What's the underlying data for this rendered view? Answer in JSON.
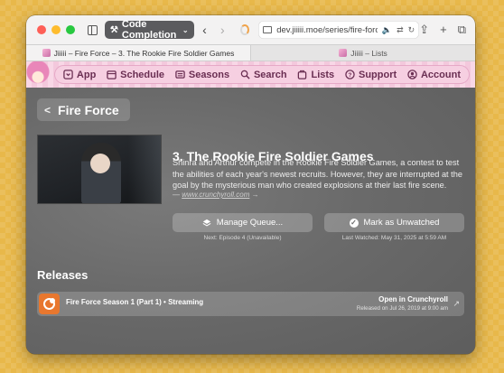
{
  "browser": {
    "tab_group_label": "Code Completion",
    "url": "dev.jiiiii.moe/series/fire-force",
    "tabs": [
      {
        "title": "Jiiiii – Fire Force – 3. The Rookie Fire Soldier Games",
        "active": true
      },
      {
        "title": "Jiiiii – Lists",
        "active": false
      }
    ]
  },
  "site_nav": {
    "items": [
      {
        "label": "App",
        "icon": "app-icon"
      },
      {
        "label": "Schedule",
        "icon": "calendar-icon"
      },
      {
        "label": "Seasons",
        "icon": "seasons-icon"
      },
      {
        "label": "Search",
        "icon": "search-icon"
      },
      {
        "label": "Lists",
        "icon": "lists-icon"
      },
      {
        "label": "Support",
        "icon": "help-icon"
      },
      {
        "label": "Account",
        "icon": "account-icon"
      }
    ]
  },
  "page": {
    "back_label": "Fire Force",
    "episode_title": "3. The Rookie Fire Soldier Games",
    "description": "Shinra and Arthur compete in the Rookie Fire Soldier Games, a contest to test the abilities of each year's newest recruits. However, they are interrupted at the goal by the mysterious man who created explosions at their last fire scene.",
    "source_prefix": "— ",
    "source_link": "www.crunchyroll.com",
    "source_suffix": " →",
    "manage_label": "Manage Queue...",
    "manage_sub": "Next: Episode 4 (Unavailable)",
    "unwatch_label": "Mark as Unwatched",
    "unwatch_sub": "Last Watched: May 31, 2025 at 5:59 AM",
    "releases_heading": "Releases",
    "releases": [
      {
        "name": "Fire Force Season 1 (Part 1) • Streaming",
        "action": "Open in Crunchyroll",
        "date": "Released on Jul 26, 2019 at 9:00 am"
      }
    ]
  },
  "colors": {
    "desktop": "#e8b84a",
    "nav_pink": "#f6cfe1",
    "crunchyroll": "#e8772e"
  }
}
